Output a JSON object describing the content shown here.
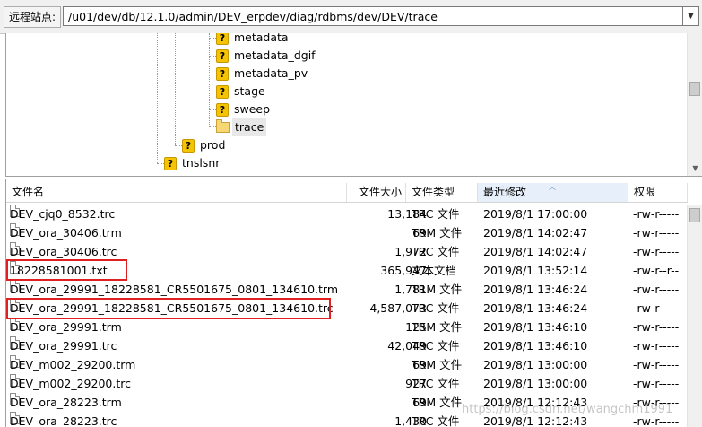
{
  "remote_site": {
    "label": "远程站点:",
    "path": "/u01/dev/db/12.1.0/admin/DEV_erpdev/diag/rdbms/dev/DEV/trace",
    "dropdown_icon": "chevron-down-icon"
  },
  "tree": {
    "nodes": [
      {
        "label": "metadata",
        "icon": "unknown-folder-icon"
      },
      {
        "label": "metadata_dgif",
        "icon": "unknown-folder-icon"
      },
      {
        "label": "metadata_pv",
        "icon": "unknown-folder-icon"
      },
      {
        "label": "stage",
        "icon": "unknown-folder-icon"
      },
      {
        "label": "sweep",
        "icon": "unknown-folder-icon"
      },
      {
        "label": "trace",
        "icon": "folder-icon",
        "selected": true
      },
      {
        "label": "prod",
        "icon": "unknown-folder-icon"
      },
      {
        "label": "tnslsnr",
        "icon": "unknown-folder-icon"
      }
    ]
  },
  "list": {
    "columns": {
      "name": "文件名",
      "size": "文件大小",
      "type": "文件类型",
      "modified": "最近修改",
      "perms": "权限"
    },
    "sorted_column": "modified",
    "files": [
      {
        "name": "DEV_cjq0_8532.trc",
        "size": "13,184",
        "type": "TRC 文件",
        "modified": "2019/8/1 17:00:00",
        "perms": "-rw-r-----"
      },
      {
        "name": "DEV_ora_30406.trm",
        "size": "69",
        "type": "TRM 文件",
        "modified": "2019/8/1 14:02:47",
        "perms": "-rw-r-----"
      },
      {
        "name": "DEV_ora_30406.trc",
        "size": "1,972",
        "type": "TRC 文件",
        "modified": "2019/8/1 14:02:47",
        "perms": "-rw-r-----"
      },
      {
        "name": "18228581001.txt",
        "size": "365,947",
        "type": "文本文档",
        "modified": "2019/8/1 13:52:14",
        "perms": "-rw-r--r--",
        "highlighted": true
      },
      {
        "name": "DEV_ora_29991_18228581_CR5501675_0801_134610.trm",
        "size": "1,781",
        "type": "TRM 文件",
        "modified": "2019/8/1 13:46:24",
        "perms": "-rw-r-----"
      },
      {
        "name": "DEV_ora_29991_18228581_CR5501675_0801_134610.trc",
        "size": "4,587,073",
        "type": "TRC 文件",
        "modified": "2019/8/1 13:46:24",
        "perms": "-rw-r-----",
        "highlighted": true
      },
      {
        "name": "DEV_ora_29991.trm",
        "size": "125",
        "type": "TRM 文件",
        "modified": "2019/8/1 13:46:10",
        "perms": "-rw-r-----"
      },
      {
        "name": "DEV_ora_29991.trc",
        "size": "42,049",
        "type": "TRC 文件",
        "modified": "2019/8/1 13:46:10",
        "perms": "-rw-r-----"
      },
      {
        "name": "DEV_m002_29200.trm",
        "size": "69",
        "type": "TRM 文件",
        "modified": "2019/8/1 13:00:00",
        "perms": "-rw-r-----"
      },
      {
        "name": "DEV_m002_29200.trc",
        "size": "927",
        "type": "TRC 文件",
        "modified": "2019/8/1 13:00:00",
        "perms": "-rw-r-----"
      },
      {
        "name": "DEV_ora_28223.trm",
        "size": "69",
        "type": "TRM 文件",
        "modified": "2019/8/1 12:12:43",
        "perms": "-rw-r-----"
      },
      {
        "name": "DEV_ora_28223.trc",
        "size": "1,430",
        "type": "TRC 文件",
        "modified": "2019/8/1 12:12:43",
        "perms": "-rw-r-----"
      }
    ]
  },
  "watermark": "https://blog.csdn.net/wangchm1991"
}
